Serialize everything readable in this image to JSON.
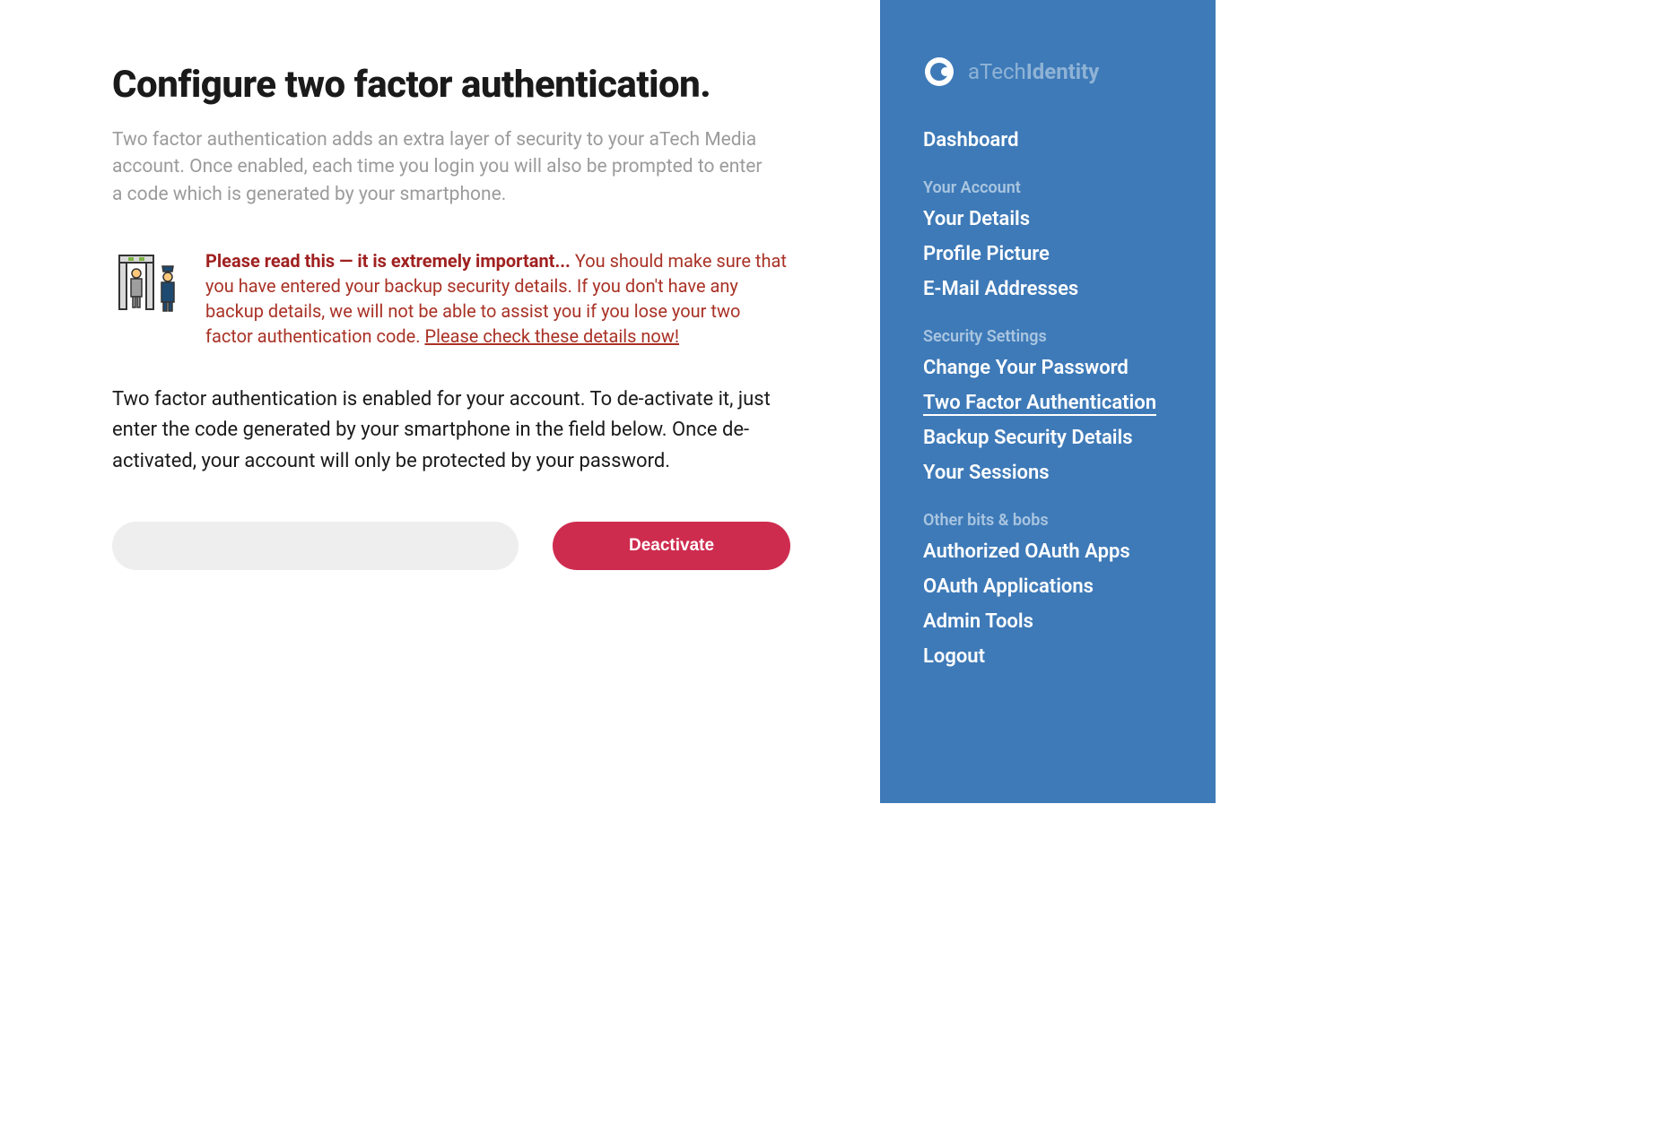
{
  "main": {
    "title": "Configure two factor authentication.",
    "intro": "Two factor authentication adds an extra layer of security to your aTech Media account. Once enabled, each time you login you will also be prompted to enter a code which is generated by your smartphone.",
    "warning_bold": "Please read this — it is extremely important...",
    "warning_body": " You should make sure that you have entered your backup security details. If you don't have any backup details, we will not be able to assist you if you lose your two factor authentication code. ",
    "warning_link": "Please check these details now!",
    "body": "Two factor authentication is enabled for your account. To de-activate it, just enter the code generated by your smartphone in the field below. Once de-activated, your account will only be protected by your password.",
    "code_value": "",
    "deactivate_label": "Deactivate"
  },
  "sidebar": {
    "brand_prefix": "aTech",
    "brand_bold": "Identity",
    "dashboard": "Dashboard",
    "sections": [
      {
        "heading": "Your Account",
        "items": [
          "Your Details",
          "Profile Picture",
          "E-Mail Addresses"
        ]
      },
      {
        "heading": "Security Settings",
        "items": [
          "Change Your Password",
          "Two Factor Authentication",
          "Backup Security Details",
          "Your Sessions"
        ]
      },
      {
        "heading": "Other bits & bobs",
        "items": [
          "Authorized OAuth Apps",
          "OAuth Applications",
          "Admin Tools",
          "Logout"
        ]
      }
    ]
  }
}
